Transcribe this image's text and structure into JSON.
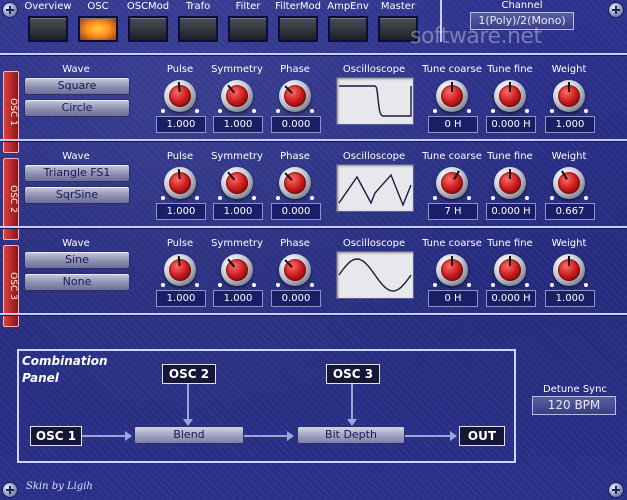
{
  "nav": {
    "tabs": [
      {
        "label": "Overview"
      },
      {
        "label": "OSC",
        "active": true
      },
      {
        "label": "OSCMod"
      },
      {
        "label": "Trafo"
      },
      {
        "label": "Filter"
      },
      {
        "label": "FilterMod"
      },
      {
        "label": "AmpEnv"
      },
      {
        "label": "Master"
      }
    ]
  },
  "channel": {
    "label": "Channel",
    "value": "1(Poly)/2(Mono)"
  },
  "watermark": "software.net",
  "columns": {
    "wave": "Wave",
    "pulse": "Pulse",
    "symmetry": "Symmetry",
    "phase": "Phase",
    "oscilloscope": "Oscilloscope",
    "tune_coarse": "Tune coarse",
    "tune_fine": "Tune fine",
    "weight": "Weight"
  },
  "oscillators": [
    {
      "tag": "OSC 1",
      "wave1": "Square",
      "wave2": "Circle",
      "pulse": "1.000",
      "symmetry": "1.000",
      "phase": "0.000",
      "tune_coarse": "0 H",
      "tune_fine": "0.000 H",
      "weight": "1.000",
      "waveform": "square"
    },
    {
      "tag": "OSC 2",
      "wave1": "Triangle FS1",
      "wave2": "SqrSine",
      "pulse": "1.000",
      "symmetry": "1.000",
      "phase": "0.000",
      "tune_coarse": "7 H",
      "tune_fine": "0.000 H",
      "weight": "0.667",
      "waveform": "triangle"
    },
    {
      "tag": "OSC 3",
      "wave1": "Sine",
      "wave2": "None",
      "pulse": "1.000",
      "symmetry": "1.000",
      "phase": "0.000",
      "tune_coarse": "0 H",
      "tune_fine": "0.000 H",
      "weight": "1.000",
      "waveform": "sine"
    }
  ],
  "combination": {
    "title": "Combination Panel",
    "osc1": "OSC 1",
    "osc2": "OSC 2",
    "osc3": "OSC 3",
    "blend": "Blend",
    "bit_depth": "Bit Depth",
    "out": "OUT"
  },
  "detune_sync": {
    "label": "Detune Sync",
    "value": "120 BPM"
  },
  "footer": {
    "credit": "Skin by Ligih"
  },
  "colors": {
    "background": "#2a2f86",
    "knob_cap": "#c81a1a",
    "osc_tag": "#c83030",
    "active_led": "#ff9020"
  }
}
